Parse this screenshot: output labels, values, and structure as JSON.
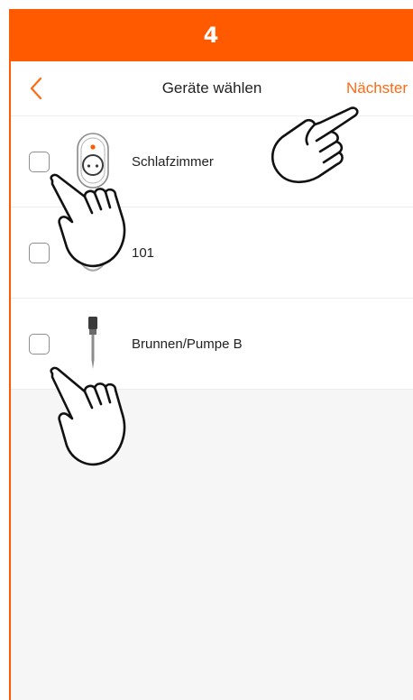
{
  "step": {
    "number": "4"
  },
  "header": {
    "back_icon": "chevron-left-icon",
    "title": "Geräte wählen",
    "next_label": "Nächster"
  },
  "devices": [
    {
      "name": "Schlafzimmer",
      "icon": "smart-plug-icon",
      "checked": false
    },
    {
      "name": "101",
      "icon": "smart-plug-icon",
      "checked": false
    },
    {
      "name": "Brunnen/Pumpe B",
      "icon": "sensor-probe-icon",
      "checked": false
    }
  ],
  "colors": {
    "accent": "#ff5a00",
    "next_text": "#ff6a13",
    "background": "#f6f6f6"
  }
}
